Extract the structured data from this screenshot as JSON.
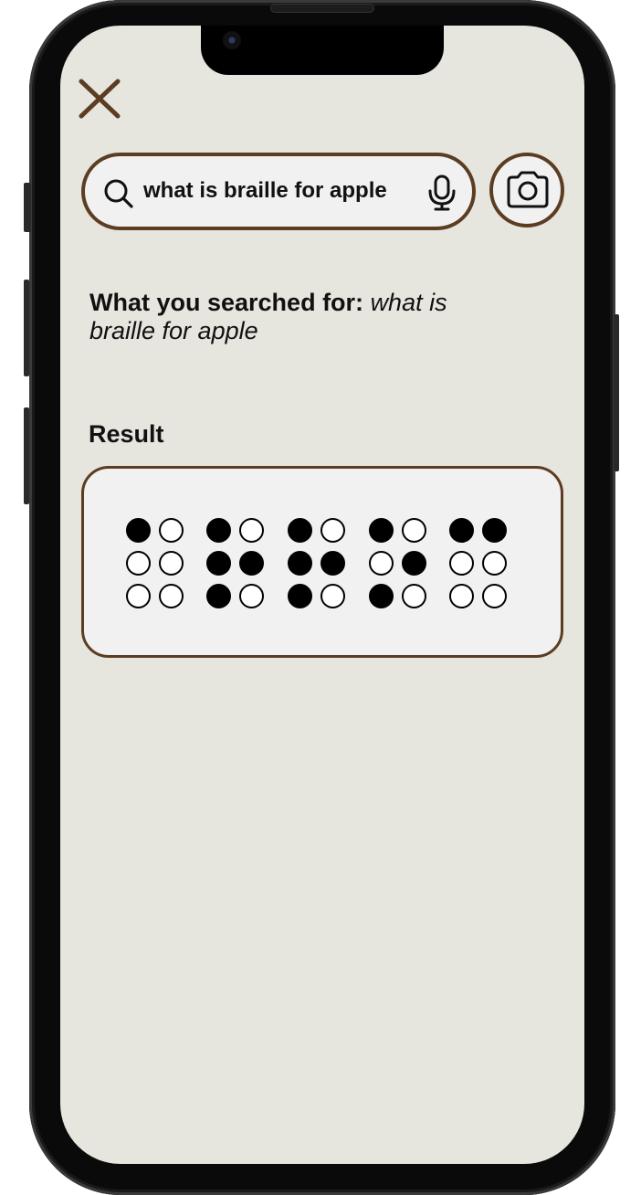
{
  "search": {
    "query": "what is braille for apple"
  },
  "results_page": {
    "searched_label": "What you searched for:",
    "searched_query": "what is braille for apple",
    "result_heading": "Result"
  },
  "braille": {
    "cells": [
      {
        "dots": [
          1,
          0,
          0,
          0,
          0,
          0
        ]
      },
      {
        "dots": [
          1,
          1,
          1,
          0,
          1,
          0
        ]
      },
      {
        "dots": [
          1,
          1,
          1,
          0,
          1,
          0
        ]
      },
      {
        "dots": [
          1,
          0,
          1,
          0,
          1,
          0
        ]
      },
      {
        "dots": [
          1,
          0,
          0,
          1,
          0,
          0
        ]
      }
    ]
  },
  "colors": {
    "accent_brown": "#5b3d22",
    "screen_bg": "#e6e5de",
    "card_bg": "#f2f1f1"
  },
  "icons": {
    "close": "close-icon",
    "search": "search-icon",
    "mic": "microphone-icon",
    "camera": "camera-icon"
  }
}
